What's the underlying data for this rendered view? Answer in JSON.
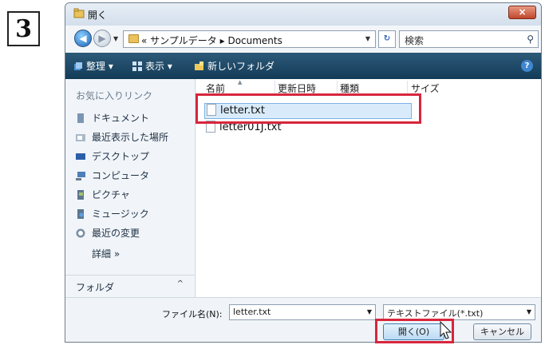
{
  "step": {
    "number": "3"
  },
  "window": {
    "title": "開く",
    "close_label": "×"
  },
  "address": {
    "path": "« サンプルデータ ▸ Documents",
    "refresh_icon": "refresh-icon",
    "search_placeholder": "検索"
  },
  "toolbar": {
    "organize_label": "整理 ▾",
    "view_label": "表示 ▾",
    "new_folder_label": "新しいフォルダ",
    "help_label": "?"
  },
  "sidebar": {
    "header": "お気に入りリンク",
    "items": [
      {
        "label": "ドキュメント",
        "icon": "documents-icon"
      },
      {
        "label": "最近表示した場所",
        "icon": "recent-places-icon"
      },
      {
        "label": "デスクトップ",
        "icon": "desktop-icon"
      },
      {
        "label": "コンピュータ",
        "icon": "computer-icon"
      },
      {
        "label": "ピクチャ",
        "icon": "pictures-icon"
      },
      {
        "label": "ミュージック",
        "icon": "music-icon"
      },
      {
        "label": "最近の変更",
        "icon": "recent-changes-icon"
      }
    ],
    "more_label": "詳細 »",
    "folders_label": "フォルダ",
    "folders_toggle": "^"
  },
  "file_list": {
    "columns": [
      "名前",
      "更新日時",
      "種類",
      "サイズ"
    ],
    "files": [
      {
        "name": "letter.txt",
        "selected": true
      },
      {
        "name": "letter01J.txt",
        "selected": false
      }
    ]
  },
  "footer": {
    "filename_label": "ファイル名(N):",
    "filename_value": "letter.txt",
    "filetype_value": "テキストファイル(*.txt)",
    "open_label": "開く(O)",
    "cancel_label": "キャンセル"
  },
  "colors": {
    "highlight": "#d7263d",
    "toolbar": "#1f4a68",
    "selection": "#d9ebfa"
  }
}
